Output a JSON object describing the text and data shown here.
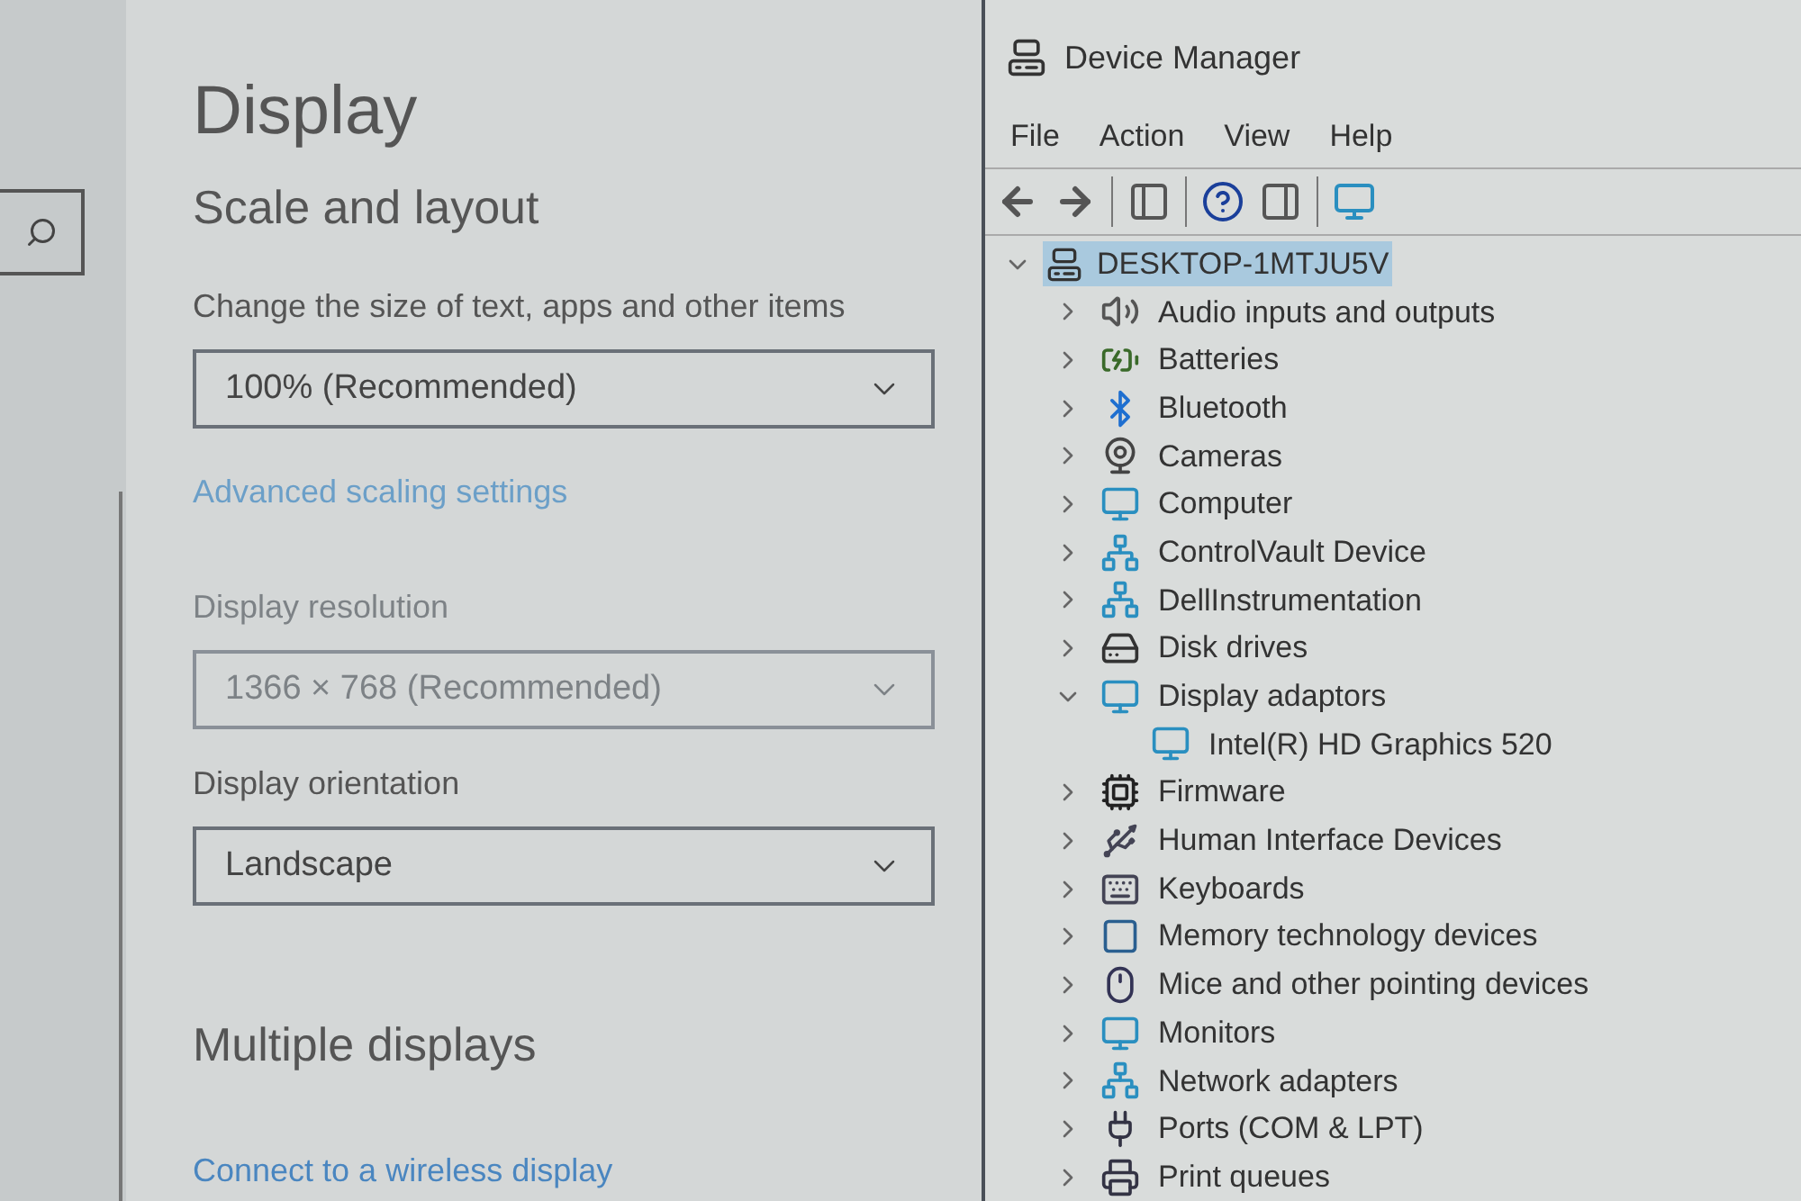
{
  "settings": {
    "title": "Display",
    "sections": [
      {
        "heading": "Scale and layout",
        "groups": [
          {
            "label": "Change the size of text, apps and other items",
            "value": "100% (Recommended)",
            "disabled": false,
            "link": "Advanced scaling settings"
          },
          {
            "label": "Display resolution",
            "value": "1366 × 768 (Recommended)",
            "disabled": true
          },
          {
            "label": "Display orientation",
            "value": "Landscape",
            "disabled": false
          }
        ]
      },
      {
        "heading": "Multiple displays",
        "link": "Connect to a wireless display"
      }
    ]
  },
  "device_manager": {
    "window": {
      "title": "Device Manager"
    },
    "menu": [
      "File",
      "Action",
      "View",
      "Help"
    ],
    "tree": {
      "label": "DESKTOP-1MTJU5V",
      "expanded": true,
      "selected": true,
      "children": [
        {
          "label": "Audio inputs and outputs",
          "expanded": false
        },
        {
          "label": "Batteries",
          "expanded": false
        },
        {
          "label": "Bluetooth",
          "expanded": false
        },
        {
          "label": "Cameras",
          "expanded": false
        },
        {
          "label": "Computer",
          "expanded": false
        },
        {
          "label": "ControlVault Device",
          "expanded": false
        },
        {
          "label": "DellInstrumentation",
          "expanded": false
        },
        {
          "label": "Disk drives",
          "expanded": false
        },
        {
          "label": "Display adaptors",
          "expanded": true,
          "children": [
            {
              "label": "Intel(R) HD Graphics 520"
            }
          ]
        },
        {
          "label": "Firmware",
          "expanded": false
        },
        {
          "label": "Human Interface Devices",
          "expanded": false
        },
        {
          "label": "Keyboards",
          "expanded": false
        },
        {
          "label": "Memory technology devices",
          "expanded": false
        },
        {
          "label": "Mice and other pointing devices",
          "expanded": false
        },
        {
          "label": "Monitors",
          "expanded": false
        },
        {
          "label": "Network adapters",
          "expanded": false
        },
        {
          "label": "Ports (COM & LPT)",
          "expanded": false
        },
        {
          "label": "Print queues",
          "expanded": false
        }
      ]
    }
  }
}
